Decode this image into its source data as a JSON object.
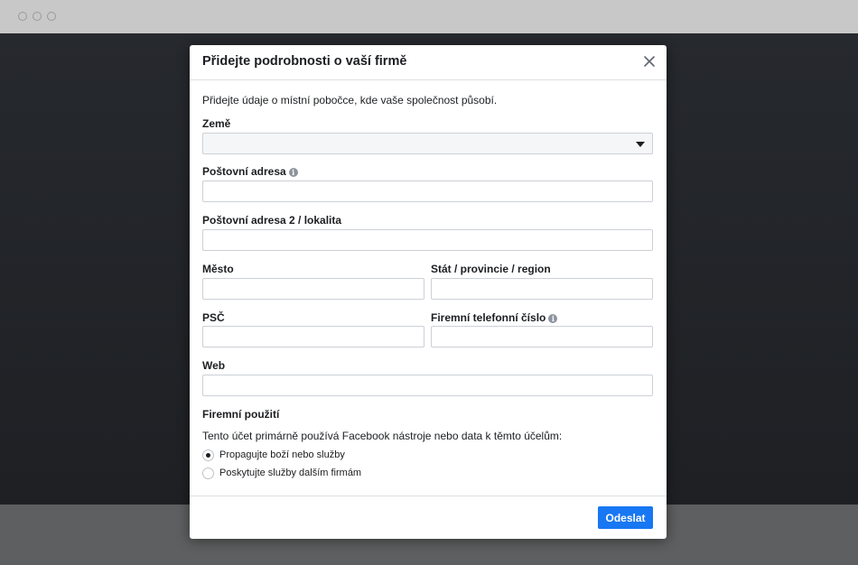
{
  "modal": {
    "title": "Přidejte podrobnosti o vaší firmě",
    "intro": "Přidejte údaje o místní pobočce, kde vaše společnost působí.",
    "fields": {
      "country": {
        "label": "Země",
        "value": ""
      },
      "address": {
        "label": "Poštovní adresa",
        "value": ""
      },
      "address2": {
        "label": "Poštovní adresa 2 / lokalita",
        "value": ""
      },
      "city": {
        "label": "Město",
        "value": ""
      },
      "state": {
        "label": "Stát / provincie / region",
        "value": ""
      },
      "zip": {
        "label": "PSČ",
        "value": ""
      },
      "phone": {
        "label": "Firemní telefonní číslo",
        "value": ""
      },
      "website": {
        "label": "Web",
        "value": ""
      }
    },
    "usage": {
      "heading": "Firemní použití",
      "text": "Tento účet primárně používá Facebook nástroje nebo data k těmto účelům:",
      "options": [
        {
          "label": "Propagujte boží nebo služby",
          "selected": true
        },
        {
          "label": "Poskytujte služby dalším firmám",
          "selected": false
        }
      ]
    },
    "submit_label": "Odeslat"
  },
  "icons": {
    "close": "close-icon",
    "info": "info-icon",
    "dropdown": "caret-down-icon"
  },
  "colors": {
    "primary": "#1877f2",
    "backdrop": "#232529"
  }
}
